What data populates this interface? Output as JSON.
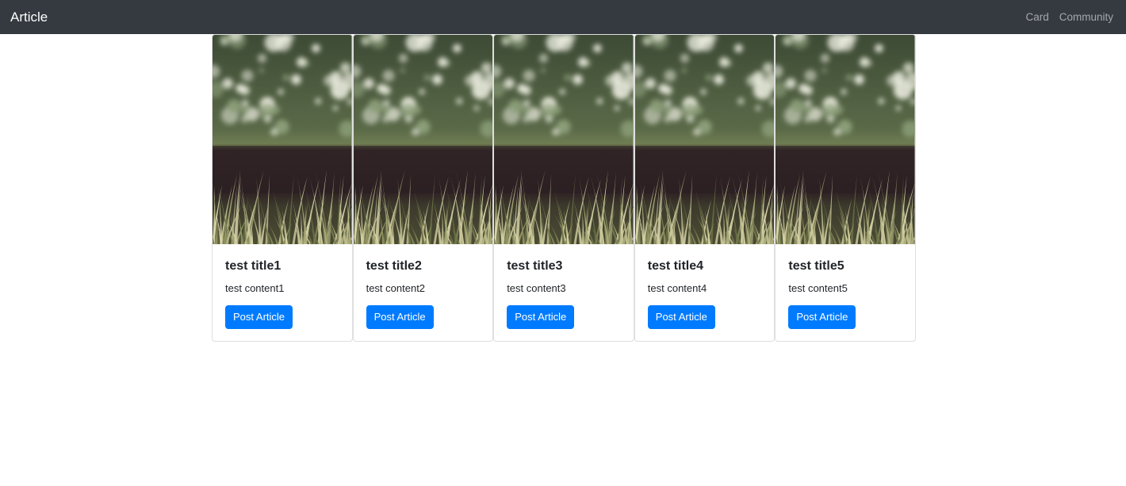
{
  "navbar": {
    "brand": "Article",
    "links": [
      "Card",
      "Community"
    ],
    "background": "#343a40"
  },
  "cards": [
    {
      "title": "test title1",
      "content": "test content1",
      "button_label": "Post Article",
      "image": "grass-photo"
    },
    {
      "title": "test title2",
      "content": "test content2",
      "button_label": "Post Article",
      "image": "grass-photo"
    },
    {
      "title": "test title3",
      "content": "test content3",
      "button_label": "Post Article",
      "image": "grass-photo"
    },
    {
      "title": "test title4",
      "content": "test content4",
      "button_label": "Post Article",
      "image": "grass-photo"
    },
    {
      "title": "test title5",
      "content": "test content5",
      "button_label": "Post Article",
      "image": "grass-photo"
    }
  ],
  "colors": {
    "primary": "#007bff",
    "navbar": "#343a40"
  }
}
